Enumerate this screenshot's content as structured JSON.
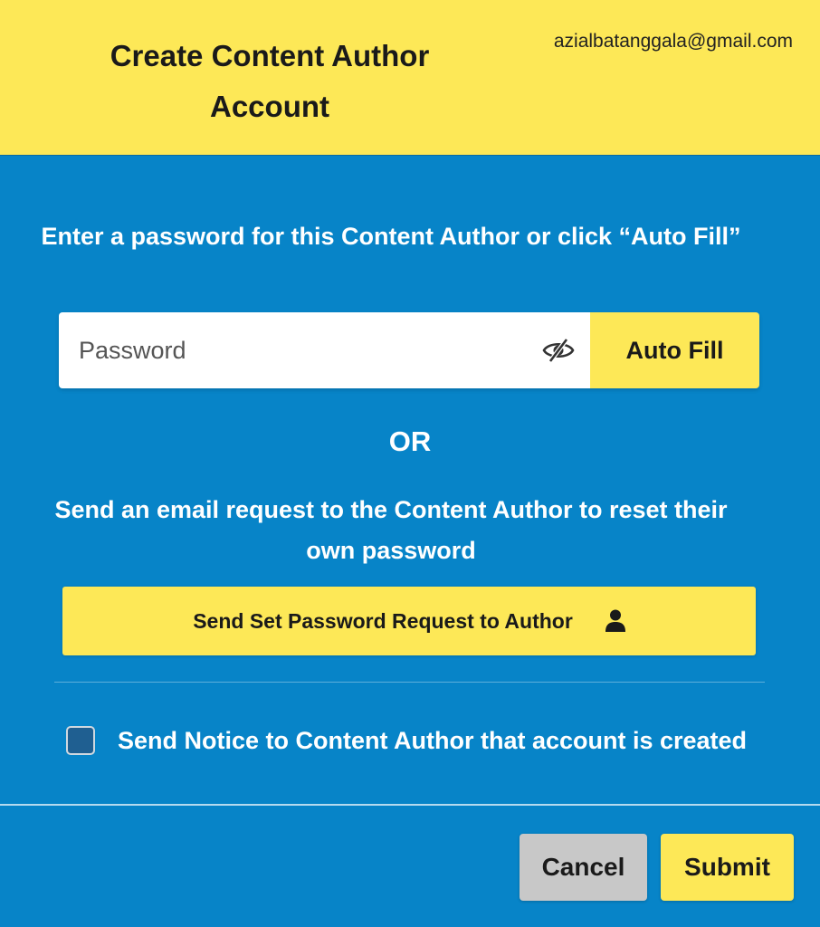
{
  "header": {
    "title": "Create Content Author Account",
    "email": "azialbatanggala@gmail.com"
  },
  "password_section": {
    "prompt": "Enter a password for this Content Author or click “Auto Fill”",
    "placeholder": "Password",
    "value": "",
    "visibility_icon": "eye-slash-icon",
    "autofill_label": "Auto Fill"
  },
  "or_label": "OR",
  "email_request": {
    "prompt": "Send an email request to the Content Author to reset their own password",
    "button_label": "Send Set Password Request to Author",
    "button_icon": "person-icon"
  },
  "notice": {
    "label": "Send Notice to Content Author that account is created",
    "checked": false
  },
  "footer": {
    "cancel_label": "Cancel",
    "submit_label": "Submit"
  },
  "colors": {
    "accent_yellow": "#fde857",
    "background_blue": "#0784c8",
    "cancel_gray": "#c8c8c8"
  }
}
